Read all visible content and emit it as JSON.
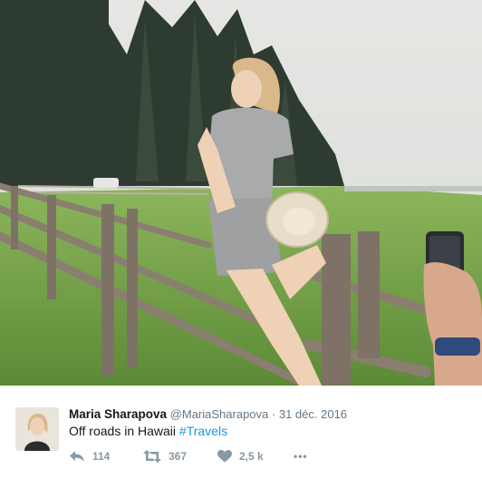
{
  "photo": {
    "alt": ""
  },
  "tweet": {
    "author_name": "Maria Sharapova",
    "author_handle": "@MariaSharapova",
    "separator": "·",
    "date": "31 déc. 2016",
    "text": "Off roads in Hawaii ",
    "hashtag": "#Travels",
    "colors": {
      "hashtag": "#1b95e0",
      "meta": "#657786",
      "icons": "#8899a6"
    }
  },
  "actions": {
    "reply": {
      "icon": "reply-icon",
      "count": "114"
    },
    "retweet": {
      "icon": "retweet-icon",
      "count": "367"
    },
    "like": {
      "icon": "heart-icon",
      "count": "2,5 k"
    },
    "more": {
      "icon": "more-icon",
      "label": "•••"
    }
  }
}
